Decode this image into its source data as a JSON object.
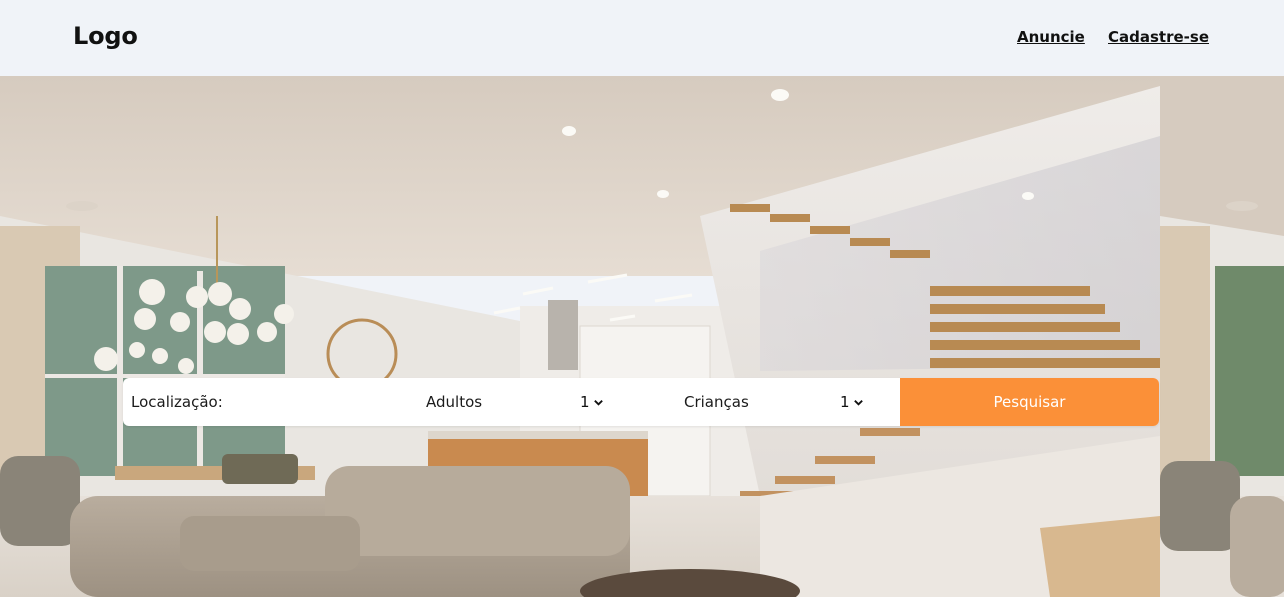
{
  "header": {
    "logo_text": "Logo",
    "nav": [
      {
        "label": "Anuncie"
      },
      {
        "label": "Cadastre-se"
      }
    ]
  },
  "hero": {
    "image_icon": "interior-photo"
  },
  "search": {
    "location_label": "Localização:",
    "location_value": "",
    "adults_label": "Adultos",
    "adults_selected": "1",
    "children_label": "Crianças",
    "children_selected": "1",
    "submit_label": "Pesquisar",
    "accent_color": "#fb9038"
  }
}
